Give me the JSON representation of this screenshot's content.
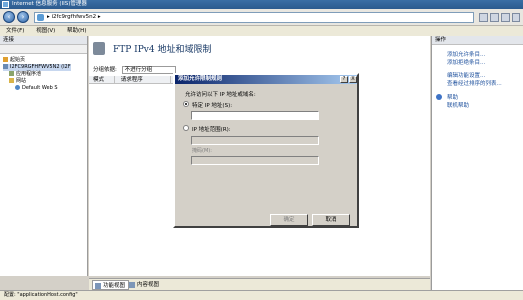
{
  "window": {
    "title": "Internet 信息服务 (IIS)管理器"
  },
  "address": {
    "path": "i2fc9rgfhfwv5n2",
    "separator": "▸"
  },
  "menu": [
    "文件(F)",
    "视图(V)",
    "帮助(H)"
  ],
  "connections": {
    "header": "连接",
    "tree": [
      {
        "label": "起始页",
        "level": 0
      },
      {
        "label": "I2FC9RGFHFWV5N2 (I2F",
        "level": 0
      },
      {
        "label": "应用程序池",
        "level": 1
      },
      {
        "label": "网站",
        "level": 1
      },
      {
        "label": "Default Web S",
        "level": 2
      }
    ]
  },
  "feature": {
    "title": "FTP IPv4 地址和域限制",
    "groupby_label": "分组依据:",
    "groupby_value": "不进行分组",
    "columns": [
      "模式",
      "请求程序"
    ]
  },
  "view_tabs": [
    "功能视图",
    "内容视图"
  ],
  "actions": {
    "header": "操作",
    "items": [
      "添加允许条目...",
      "添加拒绝条目...",
      "编辑功能设置...",
      "查看经过排序的列表..."
    ],
    "help_items": [
      "帮助",
      "联机帮助"
    ]
  },
  "dialog": {
    "title": "添加允许限制规则",
    "help_btn": "?",
    "close_btn": "X",
    "description": "允许访问以下 IP 地址或域名:",
    "option_specific": "特定 IP 地址(S):",
    "option_range": "IP 地址范围(R):",
    "mask_label": "掩码(M):",
    "ok": "确定",
    "cancel": "取消"
  },
  "status": {
    "text": "配置: \"applicationHost.config\""
  }
}
